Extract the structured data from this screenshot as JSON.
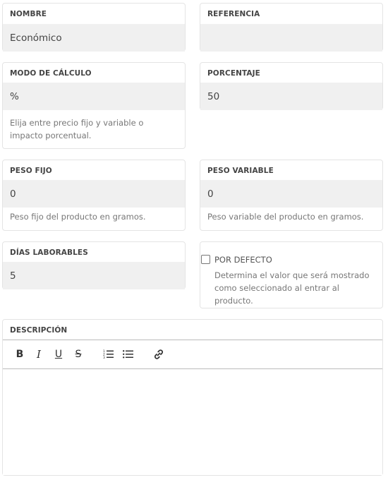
{
  "fields": {
    "nombre": {
      "label": "NOMBRE",
      "value": "Económico"
    },
    "referencia": {
      "label": "REFERENCIA",
      "value": ""
    },
    "modo_calculo": {
      "label": "MODO DE CÁLCULO",
      "value": "%",
      "help": "Elija entre precio fijo y variable o impacto porcentual."
    },
    "porcentaje": {
      "label": "PORCENTAJE",
      "value": "50"
    },
    "peso_fijo": {
      "label": "PESO FIJO",
      "value": "0",
      "help": "Peso fijo del producto en gramos."
    },
    "peso_variable": {
      "label": "PESO VARIABLE",
      "value": "0",
      "help": "Peso variable del producto en gramos."
    },
    "dias_laborables": {
      "label": "DÍAS LABORABLES",
      "value": "5"
    },
    "por_defecto": {
      "label": "POR DEFECTO",
      "checked": false,
      "help": "Determina el valor que será mostrado como seleccionado al entrar al producto."
    },
    "descripcion": {
      "label": "DESCRIPCIÓN",
      "value": ""
    }
  },
  "toolbar": {
    "bold_label": "B",
    "italic_label": "I",
    "underline_label": "U",
    "strike_label": "S",
    "icons": [
      "bold-icon",
      "italic-icon",
      "underline-icon",
      "strikethrough-icon",
      "ordered-list-icon",
      "bullet-list-icon",
      "link-icon"
    ]
  },
  "colors": {
    "field_bg": "#f0f0f0",
    "card_border": "#e4e4e4",
    "label": "#444444",
    "help_text": "#777777"
  }
}
